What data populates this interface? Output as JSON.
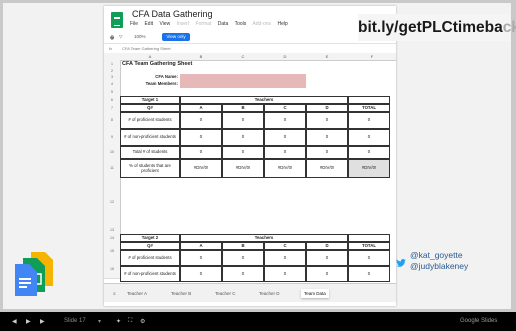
{
  "overlay": {
    "link_main": "bit.ly/getPLCtimeba",
    "link_fade": "ck",
    "handle1": "@kat_goyette",
    "handle2": "@judyblakeney"
  },
  "sheets": {
    "title": "CFA Data Gathering",
    "menu": [
      "File",
      "Edit",
      "View",
      "Insert",
      "Format",
      "Data",
      "Tools",
      "Add-ons",
      "Help"
    ],
    "toolbar_zoom": "100%",
    "view_only": "View only",
    "cell_ref": "fx",
    "formula": "CFA Team Gathering Sheet",
    "columns": [
      "A",
      "B",
      "C",
      "D",
      "E",
      "F"
    ],
    "sheet_title": "CFA Team Gathering Sheet",
    "cfa_name_label": "CFA Name:",
    "team_members_label": "Team Members:",
    "target1": "Target 1",
    "target2": "Target 2",
    "teachers": "Teachers",
    "q": "Q#",
    "teacher_cols": [
      "A",
      "B",
      "C",
      "D"
    ],
    "total": "TOTAL",
    "rows_t1": [
      {
        "label": "# of proficient students",
        "vals": [
          "0",
          "0",
          "0",
          "0",
          "0"
        ]
      },
      {
        "label": "# of non-proficient students",
        "vals": [
          "0",
          "0",
          "0",
          "0",
          "0"
        ]
      },
      {
        "label": "Total # of students",
        "vals": [
          "0",
          "0",
          "0",
          "0",
          "0"
        ]
      },
      {
        "label": "% of students that are proficient",
        "vals": [
          "#DIV/0!",
          "#DIV/0!",
          "#DIV/0!",
          "#DIV/0!",
          "#DIV/0!"
        ]
      }
    ],
    "rows_t2": [
      {
        "label": "# of proficient students",
        "vals": [
          "0",
          "0",
          "0",
          "0",
          "0"
        ]
      },
      {
        "label": "# of non-proficient students",
        "vals": [
          "0",
          "0",
          "0",
          "0",
          "0"
        ]
      }
    ],
    "row_numbers": [
      "1",
      "2",
      "3",
      "4",
      "5",
      "6",
      "7",
      "8",
      "9",
      "10",
      "11",
      "12",
      "13",
      "14",
      "15",
      "16"
    ],
    "tabs": [
      "Teacher A",
      "Teacher B",
      "Teacher C",
      "Teacher D",
      "Team Data"
    ],
    "active_tab": "Team Data"
  },
  "bar": {
    "slide_label": "Slide 17",
    "brand": "Google Slides"
  },
  "colors": {
    "pink": "#e6b8b8",
    "sheets_green": "#0f9d58",
    "accent_blue": "#1a73e8",
    "handle_blue": "#2a5c8f"
  }
}
